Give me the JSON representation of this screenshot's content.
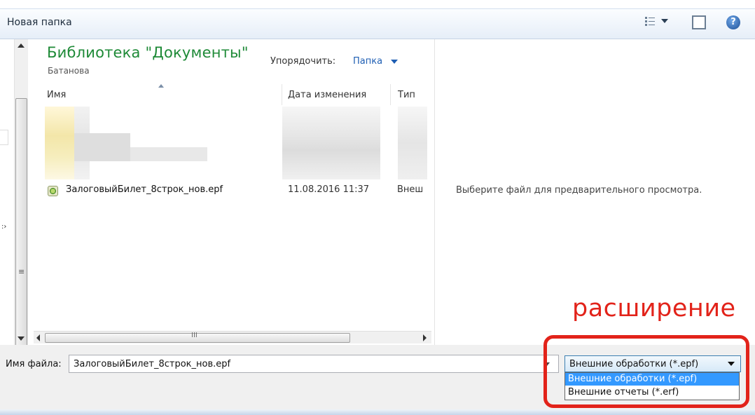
{
  "toolbar": {
    "new_folder": "Новая папка",
    "icons": [
      "views-icon",
      "pane-icon",
      "help-icon"
    ],
    "help_glyph": "?"
  },
  "library": {
    "title": "Библиотека \"Документы\"",
    "subtitle": "Батанова",
    "arrange_label": "Упорядочить:",
    "arrange_value": "Папка"
  },
  "columns": {
    "name": "Имя",
    "date": "Дата изменения",
    "type": "Тип"
  },
  "files": [
    {
      "name": "ЗалоговыйБилет_8строк_нов.epf",
      "date": "11.08.2016 11:37",
      "type": "Внешн"
    }
  ],
  "preview": {
    "message": "Выберите файл для предварительного просмотра."
  },
  "bottom": {
    "filename_label": "Имя файла:",
    "filename_value": "ЗалоговыйБилет_8строк_нов.epf",
    "filter_selected": "Внешние обработки (*.epf)",
    "filter_options": [
      "Внешние обработки (*.epf)",
      "Внешние отчеты (*.erf)"
    ]
  },
  "annotation": {
    "text": "расширение",
    "color": "#e2231a"
  },
  "colors": {
    "library_title": "#1e8a37",
    "link": "#1e5eb3",
    "selection": "#3399ff"
  }
}
